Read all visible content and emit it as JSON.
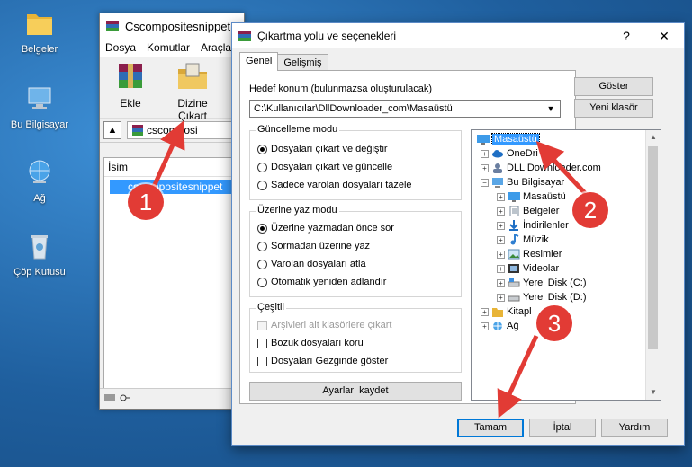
{
  "desktop": {
    "icons": [
      {
        "label": "Belgeler"
      },
      {
        "label": "Bu Bilgisayar"
      },
      {
        "label": "Ağ"
      },
      {
        "label": "Çöp Kutusu"
      }
    ]
  },
  "winrar": {
    "title": "Cscompositesnippet",
    "menu": [
      "Dosya",
      "Komutlar",
      "Araçla"
    ],
    "tools": {
      "add": "Ekle",
      "extract_to": "Dizine Çıkart"
    },
    "path": "cscomposi",
    "column_name": "İsim",
    "selected_file": "cscompositesnippet"
  },
  "dialog": {
    "title": "Çıkartma yolu ve seçenekleri",
    "help": "?",
    "close": "✕",
    "tabs": {
      "general": "Genel",
      "advanced": "Gelişmiş"
    },
    "dest_label": "Hedef konum (bulunmazsa oluşturulacak)",
    "dest_value": "C:\\Kullanıcılar\\DllDownloader_com\\Masaüstü",
    "show_button": "Göster",
    "new_folder_button": "Yeni klasör",
    "update_mode": {
      "title": "Güncelleme modu",
      "options": [
        "Dosyaları çıkart ve değiştir",
        "Dosyaları çıkart ve güncelle",
        "Sadece varolan dosyaları tazele"
      ]
    },
    "overwrite_mode": {
      "title": "Üzerine yaz modu",
      "options": [
        "Üzerine yazmadan önce sor",
        "Sormadan üzerine yaz",
        "Varolan dosyaları atla",
        "Otomatik yeniden adlandır"
      ]
    },
    "misc": {
      "title": "Çeşitli",
      "options": [
        "Arşivleri alt klasörlere çıkart",
        "Bozuk dosyaları koru",
        "Dosyaları Gezginde göster"
      ]
    },
    "save_settings": "Ayarları kaydet",
    "tree": [
      "Masaüstü",
      "OneDri",
      "DLL Downloader.com",
      "Bu Bilgisayar",
      "Masaüstü",
      "Belgeler",
      "İndirilenler",
      "Müzik",
      "Resimler",
      "Videolar",
      "Yerel Disk (C:)",
      "Yerel Disk (D:)",
      "Kitapl",
      "Ağ"
    ],
    "ok": "Tamam",
    "cancel": "İptal",
    "help_button": "Yardım"
  },
  "annotations": [
    "1",
    "2",
    "3"
  ],
  "colors": {
    "accent": "#3399ff",
    "badge": "#e23b35"
  }
}
